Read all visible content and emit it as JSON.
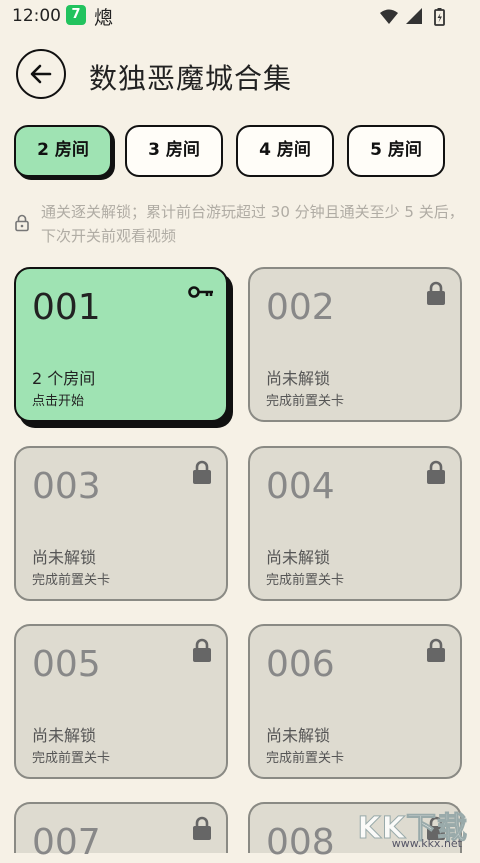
{
  "status_bar": {
    "time": "12:00",
    "app_badge": "7",
    "char": "熜"
  },
  "header": {
    "title": "数独恶魔城合集"
  },
  "tabs": [
    {
      "label": "2 房间",
      "active": true
    },
    {
      "label": "3 房间",
      "active": false
    },
    {
      "label": "4 房间",
      "active": false
    },
    {
      "label": "5 房间",
      "active": false
    }
  ],
  "notice": {
    "text": "通关逐关解锁；累计前台游玩超过 30 分钟且通关至少 5 关后，下次开关前观看视频"
  },
  "levels": [
    {
      "num": "001",
      "status": "2 个房间",
      "sub": "点击开始",
      "unlocked": true,
      "icon": "key-icon"
    },
    {
      "num": "002",
      "status": "尚未解锁",
      "sub": "完成前置关卡",
      "unlocked": false,
      "icon": "lock-icon"
    },
    {
      "num": "003",
      "status": "尚未解锁",
      "sub": "完成前置关卡",
      "unlocked": false,
      "icon": "lock-icon"
    },
    {
      "num": "004",
      "status": "尚未解锁",
      "sub": "完成前置关卡",
      "unlocked": false,
      "icon": "lock-icon"
    },
    {
      "num": "005",
      "status": "尚未解锁",
      "sub": "完成前置关卡",
      "unlocked": false,
      "icon": "lock-icon"
    },
    {
      "num": "006",
      "status": "尚未解锁",
      "sub": "完成前置关卡",
      "unlocked": false,
      "icon": "lock-icon"
    },
    {
      "num": "007",
      "status": "",
      "sub": "",
      "unlocked": false,
      "icon": "lock-icon"
    },
    {
      "num": "008",
      "status": "",
      "sub": "",
      "unlocked": false,
      "icon": "lock-icon"
    }
  ],
  "watermark": {
    "big": "KK下载",
    "small": "www.kkx.net"
  },
  "colors": {
    "background": "#f6f1e6",
    "accent_green": "#9fe3b3",
    "locked_card": "#dedbd0",
    "outline": "#111111"
  }
}
